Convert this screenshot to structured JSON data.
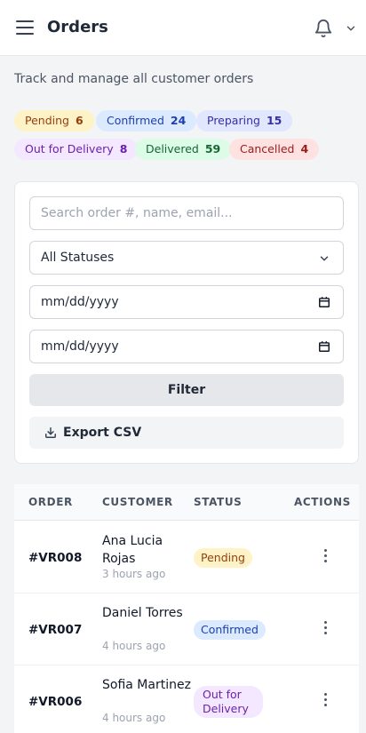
{
  "header": {
    "title": "Orders",
    "menu_icon": "hamburger-icon",
    "notification_icon": "bell-icon",
    "dropdown_icon": "chevron-down-icon"
  },
  "subtitle": "Track and manage all customer orders",
  "status_counts": [
    {
      "label": "Pending",
      "count": "6",
      "color": "#fef3c7"
    },
    {
      "label": "Confirmed",
      "count": "24",
      "color": "#dbeafe"
    },
    {
      "label": "Preparing",
      "count": "15",
      "color": "#e0e7ff"
    },
    {
      "label": "Out for Delivery",
      "count": "8",
      "color": "#f3e8ff"
    },
    {
      "label": "Delivered",
      "count": "59",
      "color": "#dcfce7"
    },
    {
      "label": "Cancelled",
      "count": "4",
      "color": "#fee2e2"
    }
  ],
  "filters": {
    "search_placeholder": "Search order #, name, email...",
    "status_selected": "All Statuses",
    "date_from": "mm/dd/yyyy",
    "date_to": "mm/dd/yyyy",
    "filter_label": "Filter",
    "export_label": "Export CSV"
  },
  "table": {
    "columns": [
      "ORDER",
      "CUSTOMER",
      "STATUS",
      "ACTIONS"
    ],
    "rows": [
      {
        "order": "#VR008",
        "customer": "Ana Lucia Rojas",
        "time": "3 hours ago",
        "status": "Pending"
      },
      {
        "order": "#VR007",
        "customer": "Daniel Torres",
        "time": "4 hours ago",
        "status": "Confirmed"
      },
      {
        "order": "#VR006",
        "customer": "Sofia Martinez",
        "time": "4 hours ago",
        "status": "Out for Delivery"
      }
    ]
  }
}
